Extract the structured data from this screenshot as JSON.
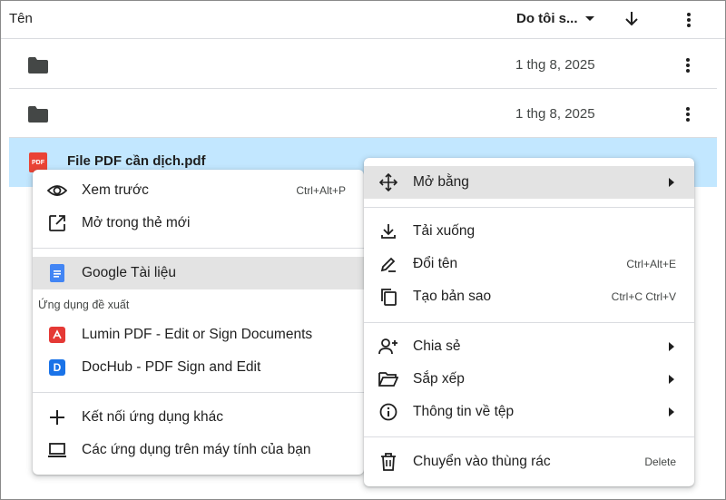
{
  "header": {
    "name_label": "Tên",
    "owner_label": "Do tôi s..."
  },
  "rows": [
    {
      "type": "folder",
      "date": "1 thg 8, 2025"
    },
    {
      "type": "folder",
      "date": "1 thg 8, 2025"
    },
    {
      "type": "pdf",
      "name": "File PDF cần dịch.pdf",
      "icon_text": "PDF"
    }
  ],
  "left_menu": {
    "preview": {
      "label": "Xem trước",
      "shortcut": "Ctrl+Alt+P"
    },
    "open_new_tab": {
      "label": "Mở trong thẻ mới"
    },
    "google_docs": {
      "label": "Google Tài liệu"
    },
    "suggested_label": "Ứng dụng đề xuất",
    "lumin": {
      "label": "Lumin PDF - Edit or Sign Documents"
    },
    "dochub": {
      "label": "DocHub - PDF Sign and Edit",
      "icon_text": "D"
    },
    "connect_more": {
      "label": "Kết nối ứng dụng khác"
    },
    "computer_apps": {
      "label": "Các ứng dụng trên máy tính của bạn"
    }
  },
  "right_menu": {
    "open_with": {
      "label": "Mở bằng"
    },
    "download": {
      "label": "Tải xuống"
    },
    "rename": {
      "label": "Đổi tên",
      "shortcut": "Ctrl+Alt+E"
    },
    "copy": {
      "label": "Tạo bản sao",
      "shortcut": "Ctrl+C Ctrl+V"
    },
    "share": {
      "label": "Chia sẻ"
    },
    "organize": {
      "label": "Sắp xếp"
    },
    "file_info": {
      "label": "Thông tin về tệp"
    },
    "trash": {
      "label": "Chuyển vào thùng rác",
      "shortcut": "Delete"
    }
  },
  "colors": {
    "selected_row": "#c2e7ff",
    "highlight": "#e3e3e3",
    "pdf_red": "#ea4335",
    "docs_blue": "#4285f4",
    "dochub_blue": "#1a73e8",
    "lumin_red": "#e53935"
  }
}
